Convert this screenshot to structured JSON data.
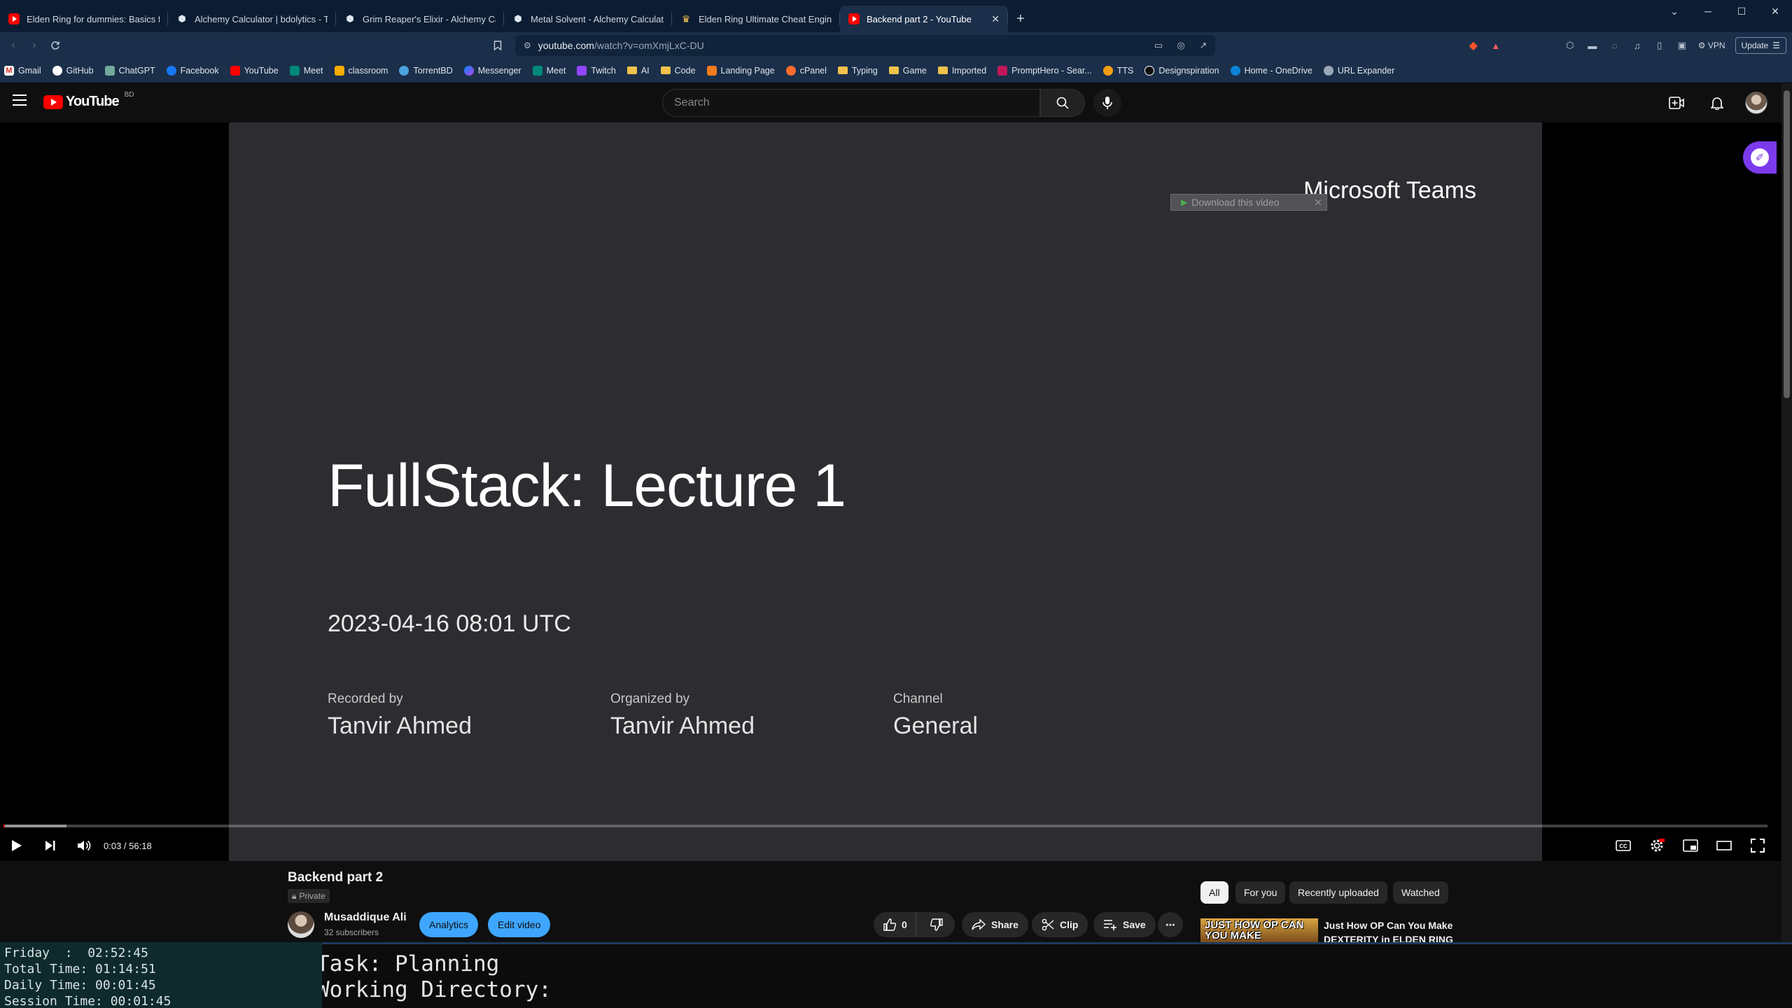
{
  "browser": {
    "tabs": [
      {
        "title": "Elden Ring for dummies: Basics for E",
        "favicon": "youtube-icon"
      },
      {
        "title": "Alchemy Calculator | bdolytics - The",
        "favicon": "alchemy-icon"
      },
      {
        "title": "Grim Reaper's Elixir - Alchemy Calcu",
        "favicon": "alchemy-icon"
      },
      {
        "title": "Metal Solvent - Alchemy Calculator |",
        "favicon": "alchemy-icon"
      },
      {
        "title": "Elden Ring Ultimate Cheat Engine Ta",
        "favicon": "elden-ring-icon"
      },
      {
        "title": "Backend part 2 - YouTube",
        "favicon": "youtube-icon",
        "active": true
      }
    ],
    "new_tab": "+",
    "url": "youtube.com",
    "url_tail": "/watch?v=omXmjLxC-DU",
    "vpn_label": "VPN",
    "update_label": "Update",
    "bookmarks": [
      {
        "label": "Gmail",
        "icon": "gmail-icon"
      },
      {
        "label": "GitHub",
        "icon": "github-icon"
      },
      {
        "label": "ChatGPT",
        "icon": "chatgpt-icon"
      },
      {
        "label": "Facebook",
        "icon": "facebook-icon"
      },
      {
        "label": "YouTube",
        "icon": "youtube-icon"
      },
      {
        "label": "Meet",
        "icon": "meet-icon"
      },
      {
        "label": "classroom",
        "icon": "classroom-icon"
      },
      {
        "label": "TorrentBD",
        "icon": "torrent-icon"
      },
      {
        "label": "Messenger",
        "icon": "messenger-icon"
      },
      {
        "label": "Meet",
        "icon": "meet-icon"
      },
      {
        "label": "Twitch",
        "icon": "twitch-icon"
      },
      {
        "label": "AI",
        "icon": "folder-icon"
      },
      {
        "label": "Code",
        "icon": "folder-icon"
      },
      {
        "label": "Landing Page",
        "icon": "landing-page-icon"
      },
      {
        "label": "cPanel",
        "icon": "cpanel-icon"
      },
      {
        "label": "Typing",
        "icon": "folder-icon"
      },
      {
        "label": "Game",
        "icon": "folder-icon"
      },
      {
        "label": "Imported",
        "icon": "folder-icon"
      },
      {
        "label": "PromptHero - Sear...",
        "icon": "prompthero-icon"
      },
      {
        "label": "TTS",
        "icon": "tts-icon"
      },
      {
        "label": "Designspiration",
        "icon": "designspiration-icon"
      },
      {
        "label": "Home - OneDrive",
        "icon": "onedrive-icon"
      },
      {
        "label": "URL Expander",
        "icon": "url-expander-icon"
      }
    ]
  },
  "youtube": {
    "logo_text": "YouTube",
    "region": "BD",
    "search_placeholder": "Search",
    "player": {
      "teams_label": "Microsoft Teams",
      "download_label": "Download this video",
      "slide_title": "FullStack: Lecture 1",
      "slide_date": "2023-04-16 08:01 UTC",
      "recorded_label": "Recorded by",
      "recorded_value": "Tanvir Ahmed",
      "organized_label": "Organized by",
      "organized_value": "Tanvir Ahmed",
      "channel_label": "Channel",
      "channel_value": "General",
      "time": "0:03 / 56:18",
      "progress_fraction": 0.0009
    },
    "video": {
      "title": "Backend part 2",
      "privacy": "Private",
      "channel_name": "Musaddique Ali",
      "subscribers": "32 subscribers",
      "analytics_label": "Analytics",
      "edit_label": "Edit video",
      "likes": "0",
      "share_label": "Share",
      "clip_label": "Clip",
      "save_label": "Save"
    },
    "chips": [
      "All",
      "For you",
      "Recently uploaded",
      "Watched"
    ],
    "recommendation": {
      "thumb_text": "JUST HOW OP CAN YOU MAKE",
      "title": "Just How OP Can You Make DEXTERITY in ELDEN RING"
    }
  },
  "time_widget": {
    "lines": [
      "Friday  :  02:52:45",
      "Total Time: 01:14:51",
      "Daily Time: 00:01:45",
      "Session Time: 00:01:45"
    ]
  },
  "terminal": {
    "line1": "Task: Planning",
    "line2": "Working Directory:"
  },
  "colors": {
    "youtube_red": "#ff0000",
    "accent_blue": "#3ea6ff",
    "browser_chrome": "#1b2f4a",
    "slide_background": "#2d2d31"
  }
}
